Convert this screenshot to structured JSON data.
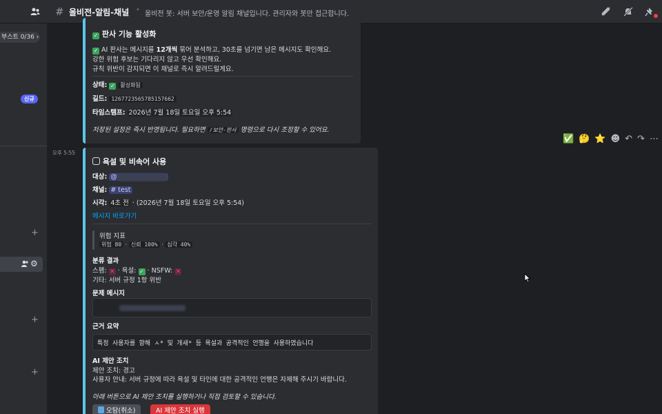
{
  "header": {
    "channel_name": "올비전-알림-채널",
    "topic": "올비전 봇: 서버 보안/운영 알림 채널입니다. 관리자와 봇만 접근합니다."
  },
  "sidebar": {
    "boost_label": "부스트 0/36",
    "new_badge": "신규"
  },
  "card1": {
    "title": "판사 기능 활성화",
    "line1_pre": "AI 판사는 메시지를 ",
    "line1_bold": "12개씩",
    "line1_post": " 묶어 분석하고, 30초를 넘기면 남은 메시지도 확인해요.",
    "line2": "강한 위험 후보는 기다리지 않고 우선 확인해요.",
    "line3": "규칙 위반이 감지되면 이 채널로 즉시 알려드릴게요.",
    "status_label": "상태:",
    "status_value": "활성화됨",
    "guild_label": "길드:",
    "guild_value": "1267723565785157662",
    "timestamp_label": "타임스탬프:",
    "timestamp_value": "2026년 7월 18일 토요일 오후 5:54",
    "footer_pre": "저장된 설정은 즉시 반영됩니다. 필요하면 ",
    "footer_code": "/보안-판사",
    "footer_post": " 명령으로 다시 조정할 수 있어요."
  },
  "message_time": "오후 5:55",
  "reactions": [
    "✅",
    "🤔",
    "⭐"
  ],
  "card2": {
    "title": "욕설 및 비속어 사용",
    "target_label": "대상:",
    "target_at": "@",
    "channel_label": "채널:",
    "channel_value": "# test",
    "time_label": "시각:",
    "time_value": "4초 전",
    "time_detail": " · (2026년 7월 18일 토요일 오후 5:54)",
    "jump_link": "메시지 바로가기",
    "risk_title": "위험 지표",
    "risk_risk": "위험 80",
    "risk_trust": "신뢰 100%",
    "risk_severity": "심각 40%",
    "class_title": "분류 결과",
    "class_spam": "스팸:",
    "class_abuse": "· 욕설:",
    "class_nsfw": "· NSFW:",
    "class_other": "기타: 서버 규정 1항 위반",
    "problem_title": "문제 메시지",
    "reason_title": "근거 요약",
    "reason_text": "특정 사용자를 향해 ㅅ* 및 개새* 등 욕설과 공격적인 언행을 사용하였습니다",
    "ai_title": "AI 제안 조치",
    "ai_action": "제안 조치: 경고",
    "ai_guide": "사용자 안내: 서버 규정에 따라 욕설 및 타인에 대한 공격적인 언행은 자제해 주시기 바랍니다.",
    "footer": "아래 버튼으로 AI 제안 조치를 실행하거나 직접 검토할 수 있습니다.",
    "btn_cancel": "오탐(취소)",
    "btn_execute": "AI 제안 조치 실행"
  }
}
